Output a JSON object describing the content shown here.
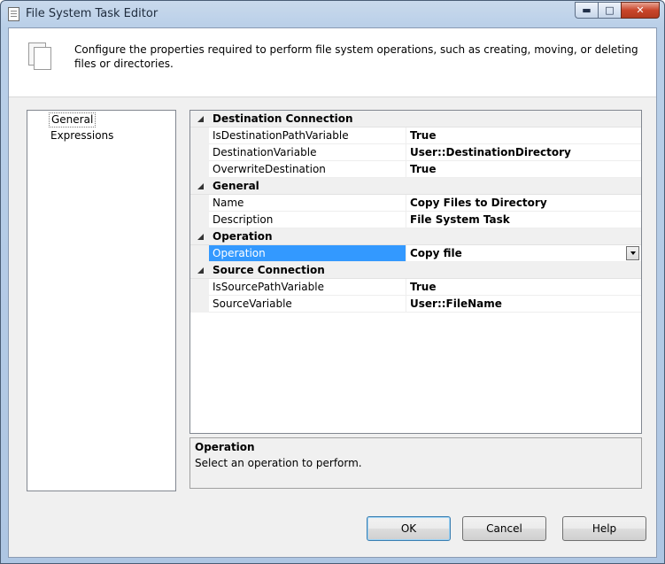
{
  "window": {
    "title": "File System Task Editor",
    "caption_buttons": {
      "minimize": "▬",
      "maximize": "□",
      "close": "✕"
    }
  },
  "header": {
    "description": "Configure the properties required to perform file system operations, such as creating, moving, or deleting files or directories."
  },
  "nav": {
    "items": [
      {
        "label": "General",
        "selected": true
      },
      {
        "label": "Expressions",
        "selected": false
      }
    ]
  },
  "properties": {
    "categories": [
      {
        "label": "Destination Connection",
        "rows": [
          {
            "name": "IsDestinationPathVariable",
            "value": "True"
          },
          {
            "name": "DestinationVariable",
            "value": "User::DestinationDirectory"
          },
          {
            "name": "OverwriteDestination",
            "value": "True"
          }
        ]
      },
      {
        "label": "General",
        "rows": [
          {
            "name": "Name",
            "value": "Copy Files to Directory"
          },
          {
            "name": "Description",
            "value": "File System Task"
          }
        ]
      },
      {
        "label": "Operation",
        "rows": [
          {
            "name": "Operation",
            "value": "Copy file",
            "selected": true,
            "dropdown": true
          }
        ]
      },
      {
        "label": "Source Connection",
        "rows": [
          {
            "name": "IsSourcePathVariable",
            "value": "True"
          },
          {
            "name": "SourceVariable",
            "value": "User::FileName"
          }
        ]
      }
    ]
  },
  "description_panel": {
    "title": "Operation",
    "text": "Select an operation to perform."
  },
  "buttons": {
    "ok": "OK",
    "cancel": "Cancel",
    "help": "Help"
  },
  "colors": {
    "selection": "#3399ff",
    "category_background": "#f0f0f0"
  }
}
